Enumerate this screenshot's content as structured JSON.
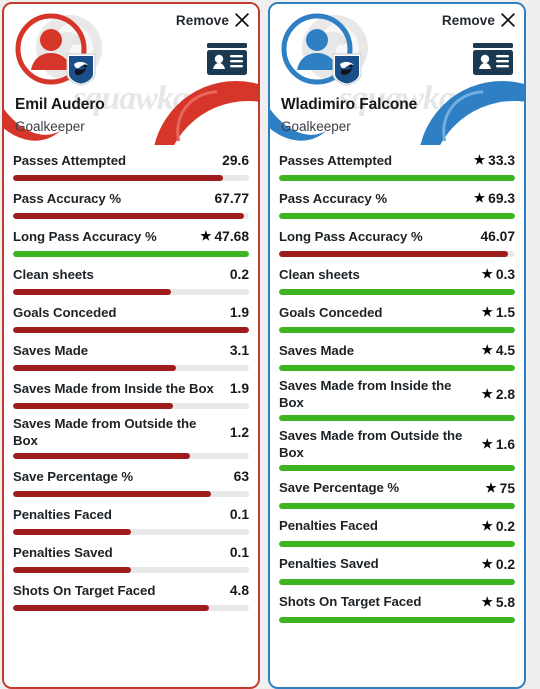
{
  "theme": {
    "left_accent": "#c23b2e",
    "right_accent": "#2e7fc1",
    "bar_win": "#3cb521",
    "bar_lose": "#a01b1b",
    "bar_track": "#e9e9e9",
    "idcard_icon": "#1b3a52"
  },
  "watermark": {
    "text": "squawka",
    "logo_icon": "squawka-logo-icon"
  },
  "common": {
    "remove_label": "Remove",
    "close_icon": "close-x-icon",
    "idcard_icon": "id-card-icon",
    "avatar_icon": "player-avatar-icon",
    "club_badge_icon": "sampdoria-badge-icon"
  },
  "cards": [
    {
      "id": "left",
      "accent": "#c23b2e",
      "theme_class": "theme-red",
      "player_name": "Emil Audero",
      "position": "Goalkeeper",
      "stats": [
        {
          "label": "Passes Attempted",
          "value": "29.6",
          "winner": false,
          "pct": 89
        },
        {
          "label": "Pass Accuracy %",
          "value": "67.77",
          "winner": false,
          "pct": 98
        },
        {
          "label": "Long Pass Accuracy %",
          "value": "47.68",
          "winner": true,
          "pct": 100
        },
        {
          "label": "Clean sheets",
          "value": "0.2",
          "winner": false,
          "pct": 67
        },
        {
          "label": "Goals Conceded",
          "value": "1.9",
          "winner": false,
          "pct": 100
        },
        {
          "label": "Saves Made",
          "value": "3.1",
          "winner": false,
          "pct": 69
        },
        {
          "label": "Saves Made from Inside the Box",
          "value": "1.9",
          "winner": false,
          "pct": 68
        },
        {
          "label": "Saves Made from Outside the Box",
          "value": "1.2",
          "winner": false,
          "pct": 75
        },
        {
          "label": "Save Percentage %",
          "value": "63",
          "winner": false,
          "pct": 84
        },
        {
          "label": "Penalties Faced",
          "value": "0.1",
          "winner": false,
          "pct": 50
        },
        {
          "label": "Penalties Saved",
          "value": "0.1",
          "winner": false,
          "pct": 50
        },
        {
          "label": "Shots On Target Faced",
          "value": "4.8",
          "winner": false,
          "pct": 83
        }
      ]
    },
    {
      "id": "right",
      "accent": "#2e7fc1",
      "theme_class": "theme-blue",
      "player_name": "Wladimiro Falcone",
      "position": "Goalkeeper",
      "stats": [
        {
          "label": "Passes Attempted",
          "value": "33.3",
          "winner": true,
          "pct": 100
        },
        {
          "label": "Pass Accuracy %",
          "value": "69.3",
          "winner": true,
          "pct": 100
        },
        {
          "label": "Long Pass Accuracy %",
          "value": "46.07",
          "winner": false,
          "pct": 97
        },
        {
          "label": "Clean sheets",
          "value": "0.3",
          "winner": true,
          "pct": 100
        },
        {
          "label": "Goals Conceded",
          "value": "1.5",
          "winner": true,
          "pct": 100
        },
        {
          "label": "Saves Made",
          "value": "4.5",
          "winner": true,
          "pct": 100
        },
        {
          "label": "Saves Made from Inside the Box",
          "value": "2.8",
          "winner": true,
          "pct": 100
        },
        {
          "label": "Saves Made from Outside the Box",
          "value": "1.6",
          "winner": true,
          "pct": 100
        },
        {
          "label": "Save Percentage %",
          "value": "75",
          "winner": true,
          "pct": 100
        },
        {
          "label": "Penalties Faced",
          "value": "0.2",
          "winner": true,
          "pct": 100
        },
        {
          "label": "Penalties Saved",
          "value": "0.2",
          "winner": true,
          "pct": 100
        },
        {
          "label": "Shots On Target Faced",
          "value": "5.8",
          "winner": true,
          "pct": 100
        }
      ]
    }
  ]
}
